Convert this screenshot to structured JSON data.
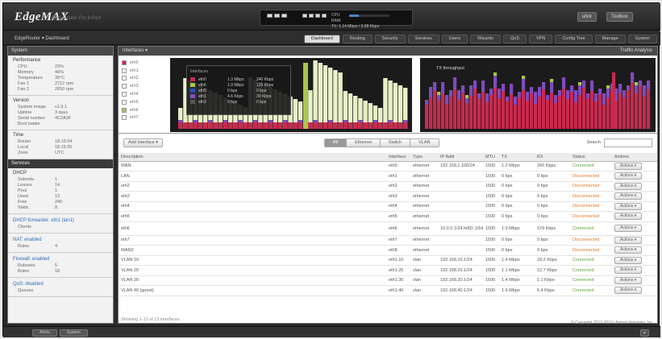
{
  "header": {
    "logo": "EdgeMAX",
    "subtitle": "EdgeRouter Pro 8-Port",
    "device_stats": [
      "CPU",
      "RAM",
      "TX: 1.14 Mbps / 9.88 Kbps"
    ],
    "user_button": "ubnt",
    "toolbox_button": "Toolbox"
  },
  "nav": {
    "breadcrumb": "EdgeRouter ▾  Dashboard",
    "tabs": [
      "Dashboard",
      "Routing",
      "Security",
      "Services",
      "Users",
      "Wizards",
      "QoS",
      "VPN",
      "Config Tree",
      "Manage",
      "System"
    ],
    "active_tab": 0
  },
  "sidebar": {
    "system_title": "System",
    "status": {
      "title": "Performance",
      "rows": [
        [
          "CPU",
          "23%"
        ],
        [
          "Memory",
          "46%"
        ],
        [
          "Temperature",
          "39°C"
        ],
        [
          "Fan 1",
          "2712 rpm"
        ],
        [
          "Fan 2",
          "2650 rpm"
        ]
      ]
    },
    "version": {
      "title": "Version",
      "rows": [
        [
          "System image",
          "v1.9.1"
        ],
        [
          "Uptime",
          "3 days"
        ],
        [
          "Serial number",
          "4C2A3F"
        ],
        [
          "Boot loader",
          ""
        ]
      ]
    },
    "time": {
      "title": "Time",
      "rows": [
        [
          "Router",
          "18:15:34"
        ],
        [
          "Local",
          "18:15:35"
        ],
        [
          "Zone",
          "UTC"
        ]
      ]
    },
    "services_title": "Services",
    "dhcp": {
      "title": "DHCP",
      "rows": [
        [
          "Subnets",
          "1"
        ],
        [
          "Leases",
          "14"
        ],
        [
          "Pool",
          "1"
        ],
        [
          "Used",
          "13"
        ],
        [
          "Free",
          "240"
        ],
        [
          "Static",
          "8"
        ]
      ]
    },
    "links": [
      {
        "title": "DHCP forwarder: eth1 (lan1)",
        "rows": [
          [
            "Clients",
            ""
          ]
        ]
      },
      {
        "title": "NAT: enabled",
        "rows": [
          [
            "Rules",
            "4"
          ]
        ]
      },
      {
        "title": "Firewall: enabled",
        "rows": [
          [
            "Rulesets",
            "5"
          ],
          [
            "Rules",
            "18"
          ]
        ]
      },
      {
        "title": "QoS: disabled",
        "rows": [
          [
            "Queues",
            ""
          ]
        ]
      }
    ]
  },
  "main": {
    "title": "Interfaces ▾",
    "right": "Traffic Analysis",
    "legend": [
      "eth0",
      "eth1",
      "eth2",
      "eth3",
      "eth4",
      "eth5",
      "eth6",
      "eth7"
    ],
    "legend_colors": [
      "#c82a4e",
      "#ffffff",
      "#ffffff",
      "#ffffff",
      "#ffffff",
      "#ffffff",
      "#a8c64a",
      "#ffffff"
    ],
    "overlay": {
      "title": "Interfaces",
      "headers": [
        "",
        "Name",
        "RX rate",
        "TX rate"
      ],
      "rows": [
        [
          "eth0",
          "1.3 Mbps",
          "240 Kbps"
        ],
        [
          "eth6",
          "1.9 Mbps",
          "129 Kbps"
        ],
        [
          "eth5",
          "0 bps",
          "0 bps"
        ],
        [
          "eth1",
          "4.6 Kbps",
          "30 Kbps"
        ],
        [
          "eth2",
          "0 bps",
          "0 bps"
        ]
      ],
      "colors": [
        "#c82a4e",
        "#a8c64a",
        "#2a4cc2",
        "#8a4ec2",
        "#555555"
      ]
    },
    "graph2_title": "TX throughput",
    "add_button": "Add Interface ▾",
    "filters": [
      "All",
      "Ethernet",
      "Switch",
      "VLAN"
    ],
    "active_filter": 0,
    "search_label": "Search",
    "columns": [
      "Description",
      "",
      "Interface",
      "Type",
      "IP Addr",
      "MTU",
      "TX",
      "RX",
      "Status",
      "Actions"
    ],
    "rows": [
      [
        "WAN",
        "eth0",
        "ethernet",
        "192.168.1.100/24",
        "1500",
        "1.2 Mbps",
        "260 Kbps",
        "Connected"
      ],
      [
        "LAN",
        "eth1",
        "ethernet",
        "",
        "1500",
        "0 bps",
        "0 bps",
        "Disconnected"
      ],
      [
        "eth2",
        "eth2",
        "ethernet",
        "",
        "1500",
        "0 bps",
        "0 bps",
        "Disconnected"
      ],
      [
        "eth3",
        "eth3",
        "ethernet",
        "",
        "1500",
        "0 bps",
        "0 bps",
        "Disconnected"
      ],
      [
        "eth4",
        "eth4",
        "ethernet",
        "",
        "1500",
        "0 bps",
        "0 bps",
        "Disconnected"
      ],
      [
        "eth5",
        "eth5",
        "ethernet",
        "",
        "1500",
        "0 bps",
        "0 bps",
        "Disconnected"
      ],
      [
        "eth6",
        "eth6",
        "ethernet",
        "10.0.0.1/24 fe80::1/64",
        "1500",
        "1.9 Mbps",
        "129 Kbps",
        "Connected"
      ],
      [
        "eth7",
        "eth7",
        "ethernet",
        "",
        "1500",
        "0 bps",
        "0 bps",
        "Disconnected"
      ],
      [
        "WAN2",
        "eth8",
        "ethernet",
        "",
        "1500",
        "0 bps",
        "0 bps",
        "Disconnected"
      ],
      [
        "VLAN 10",
        "eth1.10",
        "vlan",
        "192.168.10.1/24",
        "1500",
        "1.4 Mbps",
        "18.2 Kbps",
        "Connected"
      ],
      [
        "VLAN 20",
        "eth1.20",
        "vlan",
        "192.168.20.1/24",
        "1500",
        "1.1 Mbps",
        "12.7 Kbps",
        "Connected"
      ],
      [
        "VLAN 30",
        "eth1.30",
        "vlan",
        "192.168.30.1/24",
        "1500",
        "1.4 Mbps",
        "1.1 Kbps",
        "Connected"
      ],
      [
        "VLAN 40 (guest)",
        "eth1.40",
        "vlan",
        "192.168.40.1/24",
        "1500",
        "1.6 Mbps",
        "5.4 Kbps",
        "Connected"
      ]
    ],
    "action_label": "Actions ▾",
    "footer": "Showing 1-13 of 13 interfaces"
  },
  "copyright": "© Copyright 2012-2016 Ubiquiti Networks, Inc.",
  "bottom": [
    "Alerts",
    "System"
  ],
  "chart_colors": {
    "red": "#c82a4e",
    "green": "#a8c64a",
    "purple": "#7f4bbd",
    "cream": "#e9efc7"
  }
}
